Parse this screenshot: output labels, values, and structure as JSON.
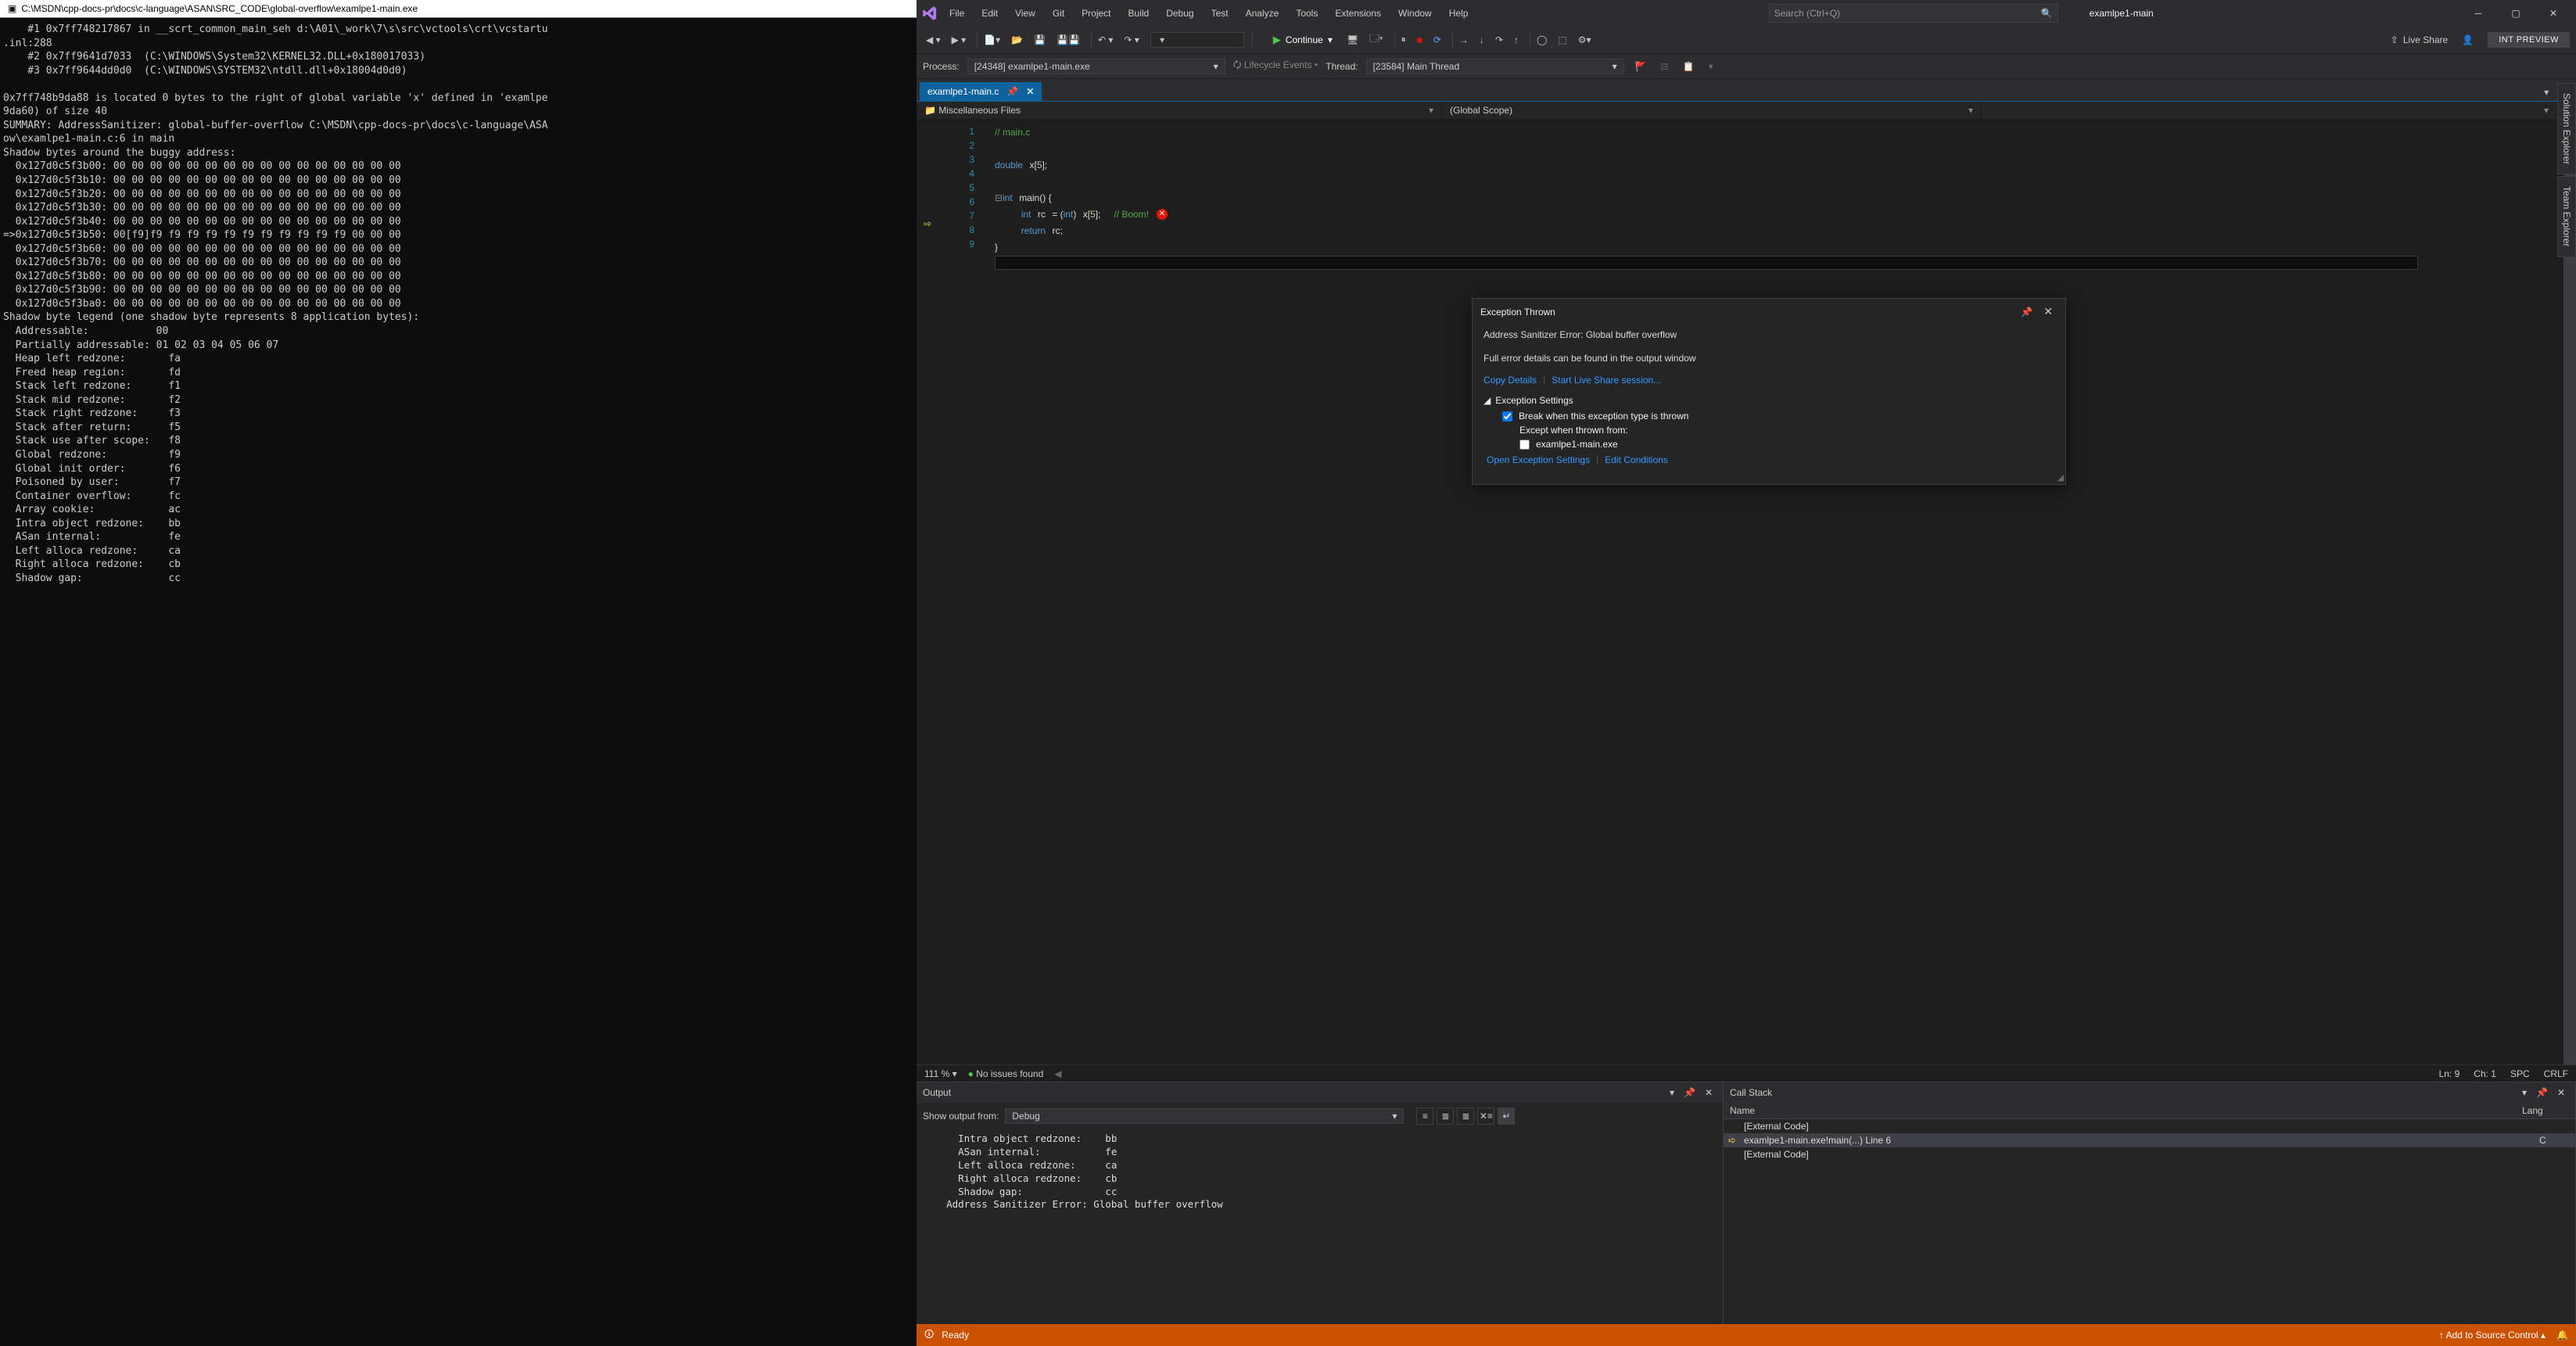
{
  "console": {
    "title": "C:\\MSDN\\cpp-docs-pr\\docs\\c-language\\ASAN\\SRC_CODE\\global-overflow\\examlpe1-main.exe",
    "body": "    #1 0x7ff748217867 in __scrt_common_main_seh d:\\A01\\_work\\7\\s\\src\\vctools\\crt\\vcstartu\n.inl:288\n    #2 0x7ff9641d7033  (C:\\WINDOWS\\System32\\KERNEL32.DLL+0x180017033)\n    #3 0x7ff9644dd0d0  (C:\\WINDOWS\\SYSTEM32\\ntdll.dll+0x18004d0d0)\n\n0x7ff748b9da88 is located 0 bytes to the right of global variable 'x' defined in 'examlpe\n9da60) of size 40\nSUMMARY: AddressSanitizer: global-buffer-overflow C:\\MSDN\\cpp-docs-pr\\docs\\c-language\\ASA\now\\examlpe1-main.c:6 in main\nShadow bytes around the buggy address:\n  0x127d0c5f3b00: 00 00 00 00 00 00 00 00 00 00 00 00 00 00 00 00\n  0x127d0c5f3b10: 00 00 00 00 00 00 00 00 00 00 00 00 00 00 00 00\n  0x127d0c5f3b20: 00 00 00 00 00 00 00 00 00 00 00 00 00 00 00 00\n  0x127d0c5f3b30: 00 00 00 00 00 00 00 00 00 00 00 00 00 00 00 00\n  0x127d0c5f3b40: 00 00 00 00 00 00 00 00 00 00 00 00 00 00 00 00\n=>0x127d0c5f3b50: 00[f9]f9 f9 f9 f9 f9 f9 f9 f9 f9 f9 f9 00 00 00\n  0x127d0c5f3b60: 00 00 00 00 00 00 00 00 00 00 00 00 00 00 00 00\n  0x127d0c5f3b70: 00 00 00 00 00 00 00 00 00 00 00 00 00 00 00 00\n  0x127d0c5f3b80: 00 00 00 00 00 00 00 00 00 00 00 00 00 00 00 00\n  0x127d0c5f3b90: 00 00 00 00 00 00 00 00 00 00 00 00 00 00 00 00\n  0x127d0c5f3ba0: 00 00 00 00 00 00 00 00 00 00 00 00 00 00 00 00\nShadow byte legend (one shadow byte represents 8 application bytes):\n  Addressable:           00\n  Partially addressable: 01 02 03 04 05 06 07\n  Heap left redzone:       fa\n  Freed heap region:       fd\n  Stack left redzone:      f1\n  Stack mid redzone:       f2\n  Stack right redzone:     f3\n  Stack after return:      f5\n  Stack use after scope:   f8\n  Global redzone:          f9\n  Global init order:       f6\n  Poisoned by user:        f7\n  Container overflow:      fc\n  Array cookie:            ac\n  Intra object redzone:    bb\n  ASan internal:           fe\n  Left alloca redzone:     ca\n  Right alloca redzone:    cb\n  Shadow gap:              cc"
  },
  "vs": {
    "menus": [
      "File",
      "Edit",
      "View",
      "Git",
      "Project",
      "Build",
      "Debug",
      "Test",
      "Analyze",
      "Tools",
      "Extensions",
      "Window",
      "Help"
    ],
    "search_placeholder": "Search (Ctrl+Q)",
    "doc_title": "examlpe1-main",
    "continue_label": "Continue",
    "liveshare_label": "Live Share",
    "int_preview": "INT PREVIEW",
    "process_label": "Process:",
    "process_value": "[24348] examlpe1-main.exe",
    "lifecycle_label": "Lifecycle Events",
    "thread_label": "Thread:",
    "thread_value": "[23584] Main Thread",
    "tab_name": "examlpe1-main.c",
    "nav1": "Miscellaneous Files",
    "nav2": "(Global Scope)",
    "side_tabs": [
      "Solution Explorer",
      "Team Explorer"
    ],
    "zoom": "111 %",
    "issues": "No issues found",
    "ln": "Ln: 9",
    "ch": "Ch: 1",
    "spc": "SPC",
    "crlf": "CRLF",
    "code_lines": [
      "1",
      "2",
      "3",
      "4",
      "5",
      "6",
      "7",
      "8",
      "9"
    ]
  },
  "exception": {
    "title": "Exception Thrown",
    "message": "Address Sanitizer Error: Global buffer overflow",
    "sub": "Full error details can be found in the output window",
    "copy": "Copy Details",
    "startls": "Start Live Share session...",
    "settings_hdr": "Exception Settings",
    "break_label": "Break when this exception type is thrown",
    "except_label": "Except when thrown from:",
    "except_item": "examlpe1-main.exe",
    "open_settings": "Open Exception Settings",
    "edit_cond": "Edit Conditions"
  },
  "output": {
    "title": "Output",
    "show_from": "Show output from:",
    "source": "Debug",
    "body": "      Intra object redzone:    bb\n      ASan internal:           fe\n      Left alloca redzone:     ca\n      Right alloca redzone:    cb\n      Shadow gap:              cc\n    Address Sanitizer Error: Global buffer overflow\n"
  },
  "callstack": {
    "title": "Call Stack",
    "col_name": "Name",
    "col_lang": "Lang",
    "rows": [
      {
        "txt": "[External Code]",
        "lang": "",
        "sel": false,
        "arrow": ""
      },
      {
        "txt": "examlpe1-main.exe!main(...) Line 6",
        "lang": "C",
        "sel": true,
        "arrow": "➪"
      },
      {
        "txt": "[External Code]",
        "lang": "",
        "sel": false,
        "arrow": ""
      }
    ]
  },
  "status": {
    "ready": "Ready",
    "srcctrl": "Add to Source Control"
  }
}
